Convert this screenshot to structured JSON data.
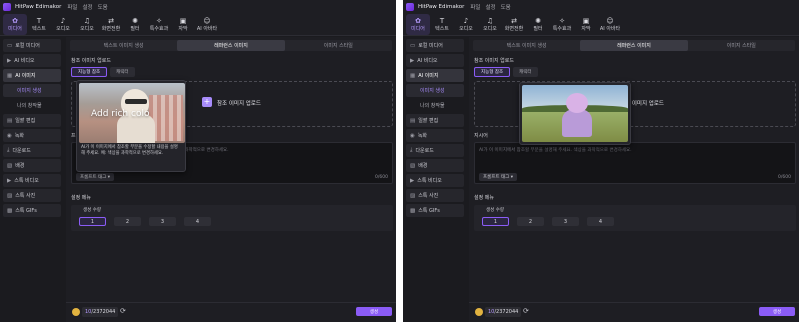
{
  "app": {
    "title": "HitPaw Edimakor",
    "menus": [
      "파일",
      "설정",
      "도움"
    ]
  },
  "toolbar": [
    {
      "label": "미디어",
      "icon": "media-icon",
      "glyph": "✿",
      "active": true
    },
    {
      "label": "텍스트",
      "icon": "text-icon",
      "glyph": "T",
      "active": false
    },
    {
      "label": "오디오",
      "icon": "audio-icon",
      "glyph": "♪",
      "active": false
    },
    {
      "label": "오디오",
      "icon": "music-note-icon",
      "glyph": "♫",
      "active": false
    },
    {
      "label": "화면전환",
      "icon": "transition-icon",
      "glyph": "⇄",
      "active": false
    },
    {
      "label": "필터",
      "icon": "filter-icon",
      "glyph": "✺",
      "active": false
    },
    {
      "label": "특수효과",
      "icon": "effects-icon",
      "glyph": "✧",
      "active": false
    },
    {
      "label": "자막",
      "icon": "subtitle-icon",
      "glyph": "▣",
      "active": false
    },
    {
      "label": "AI 아바타",
      "icon": "ai-avatar-icon",
      "glyph": "☺",
      "active": false
    }
  ],
  "sidebar": [
    {
      "label": "로컬 미디어",
      "icon": "folder-icon",
      "glyph": "▭",
      "type": "item",
      "active": false
    },
    {
      "label": "AI 비디오",
      "icon": "ai-video-icon",
      "glyph": "▶",
      "type": "item",
      "active": false
    },
    {
      "label": "AI 이미지",
      "icon": "ai-image-icon",
      "glyph": "▦",
      "type": "item",
      "active": true
    },
    {
      "label": "이미지 생성",
      "icon": "",
      "glyph": "",
      "type": "sub",
      "active": true
    },
    {
      "label": "나의 창작물",
      "icon": "",
      "glyph": "",
      "type": "sub",
      "active": false
    },
    {
      "label": "일괄 편집",
      "icon": "batch-edit-icon",
      "glyph": "▤",
      "type": "item",
      "active": false
    },
    {
      "label": "녹화",
      "icon": "record-icon",
      "glyph": "◉",
      "type": "item",
      "active": false
    },
    {
      "label": "다운로드",
      "icon": "download-icon",
      "glyph": "⤓",
      "type": "item",
      "active": false
    },
    {
      "label": "배경",
      "icon": "background-icon",
      "glyph": "▧",
      "type": "item",
      "active": false
    },
    {
      "label": "스톡 비디오",
      "icon": "stock-video-icon",
      "glyph": "▶",
      "type": "item",
      "active": false
    },
    {
      "label": "스톡 사진",
      "icon": "stock-photo-icon",
      "glyph": "▨",
      "type": "item",
      "active": false
    },
    {
      "label": "스톡 GIFs",
      "icon": "stock-gif-icon",
      "glyph": "▩",
      "type": "item",
      "active": false
    }
  ],
  "tabs": [
    {
      "label": "텍스트 이미지 생성",
      "active": false
    },
    {
      "label": "레퍼런스 이미지",
      "active": true
    },
    {
      "label": "이미지 스타일",
      "active": false
    }
  ],
  "reference": {
    "section_label": "참조 이미지 업로드",
    "pills": [
      {
        "label": "지능형 참조",
        "active": true
      },
      {
        "label": "캐릭터",
        "active": false
      }
    ],
    "upload_label": "참조 이미지 업로드"
  },
  "prompt": {
    "label": "프롬프트",
    "placeholder": "AI가 이 이미지에서 참조할 부분을 설명해 주세요. 색상을 과학적으로 변경하세요.",
    "tag_button": "프롬프트 태그",
    "counter": "0/600"
  },
  "settings": {
    "label": "설정 메뉴",
    "count_label": "생성 수량",
    "counts": [
      "1",
      "2",
      "3",
      "4"
    ],
    "selected": "1"
  },
  "footer": {
    "credits_used": "10",
    "credits_total": "/2372044",
    "generate": "생성"
  },
  "tooltip_left": {
    "caption": "Add rich colo",
    "description": "AI가 이 이미지에서 참조할 부분을 수정할 내용을 설명해 주세요. 예: 색상을 과학적으로 변경하세요."
  },
  "right_pane": {
    "prompt_label": "지시어"
  }
}
